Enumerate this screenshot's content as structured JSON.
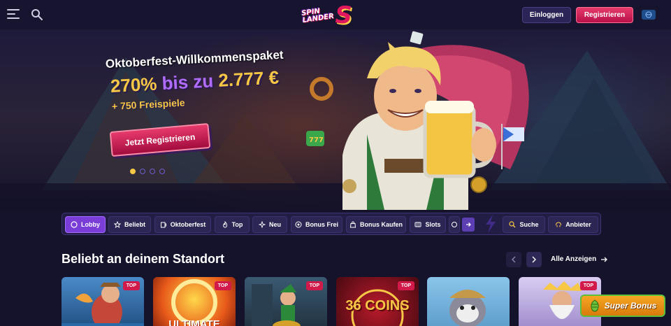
{
  "header": {
    "logo_top": "SPIN",
    "logo_bottom": "LANDER",
    "logo_mark": "S",
    "login_label": "Einloggen",
    "register_label": "Registrieren"
  },
  "hero": {
    "title": "Oktoberfest-Willkommenspaket",
    "offer_prefix": "270%",
    "offer_mid": " bis zu ",
    "offer_amount": "2.777 €",
    "spins": "+ 750 Freispiele",
    "cta_label": "Jetzt Registrieren",
    "slides_count": 4,
    "active_slide": 1
  },
  "categories": [
    {
      "label": "Lobby",
      "icon": "lobby-icon",
      "active": true
    },
    {
      "label": "Beliebt",
      "icon": "star-icon",
      "active": false
    },
    {
      "label": "Oktoberfest",
      "icon": "mug-icon",
      "active": false
    },
    {
      "label": "Top",
      "icon": "flame-icon",
      "active": false
    },
    {
      "label": "Neu",
      "icon": "sparkle-icon",
      "active": false
    },
    {
      "label": "Bonus Frei",
      "icon": "bonus-icon",
      "active": false
    },
    {
      "label": "Bonus Kaufen",
      "icon": "bag-icon",
      "active": false
    },
    {
      "label": "Slots",
      "icon": "slots-icon",
      "active": false
    }
  ],
  "tools": {
    "search_label": "Suche",
    "providers_label": "Anbieter"
  },
  "section": {
    "title": "Beliebt an deinem Standort",
    "see_all_label": "Alle Anzeigen"
  },
  "games": [
    {
      "badge": "TOP",
      "label": "",
      "theme": "#3a6fa8"
    },
    {
      "badge": "TOP",
      "label": "ULTIMATE",
      "theme": "#d9421a"
    },
    {
      "badge": "TOP",
      "label": "",
      "theme": "#2c4a5c"
    },
    {
      "badge": "TOP",
      "label": "36 COINS",
      "theme": "#7a0f1c"
    },
    {
      "badge": "",
      "label": "",
      "theme": "#6aa8d8"
    },
    {
      "badge": "TOP",
      "label": "",
      "theme": "#c9b8e8"
    }
  ],
  "floating": {
    "super_bonus_label": "Super Bonus"
  },
  "colors": {
    "accent_gold": "#f7c746",
    "accent_pink": "#e63a6b",
    "accent_purple": "#7a3dd8",
    "bg": "#15132b"
  }
}
